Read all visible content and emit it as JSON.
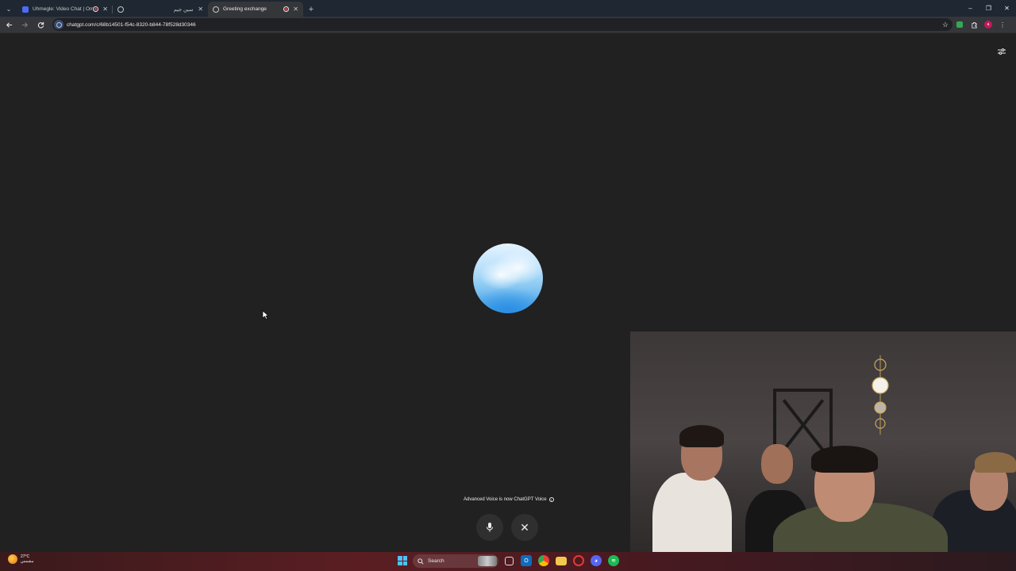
{
  "browser": {
    "tabs": [
      {
        "title": "Uhmegle: Video Chat | Omegle Alternative",
        "favicon_color": "#4a6cf7",
        "recording": true,
        "active": false
      },
      {
        "title": "سين جيم",
        "favicon_color": "#c4c7c5",
        "recording": false,
        "active": false
      },
      {
        "title": "Greeting exchange",
        "favicon_color": "#c4c7c5",
        "recording": true,
        "active": true
      }
    ],
    "new_tab_label": "+",
    "url": "chatgpt.com/c/68b14501-f54c-8320-b844-78f528d30346",
    "window_controls": {
      "minimize": "–",
      "restore": "❐",
      "close": "✕"
    }
  },
  "voice": {
    "notice": "Advanced Voice is now ChatGPT Voice",
    "info_glyph": "i",
    "mic_icon": "mic-icon",
    "end_icon": "close-icon",
    "end_glyph": "✕",
    "orb_colors": [
      "#e6f4ff",
      "#8ccaf3",
      "#2b8fe3"
    ]
  },
  "taskbar": {
    "weather": {
      "temp": "27°C",
      "condition": "مشمس"
    },
    "search_placeholder": "Search",
    "apps": [
      "task-view",
      "outlook",
      "chrome",
      "file-explorer",
      "app-red",
      "discord",
      "spotify"
    ]
  }
}
